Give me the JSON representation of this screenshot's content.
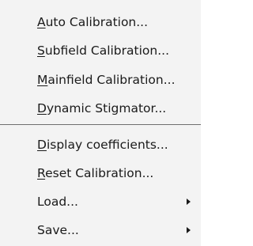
{
  "menu": {
    "items": [
      {
        "mnemonic": "A",
        "rest": "uto Calibration...",
        "submenu": false
      },
      {
        "mnemonic": "S",
        "rest": "ubfield Calibration...",
        "submenu": false
      },
      {
        "mnemonic": "M",
        "rest": "ainfield Calibration...",
        "submenu": false
      },
      {
        "mnemonic": "D",
        "rest": "ynamic Stigmator...",
        "submenu": false
      },
      {
        "mnemonic": "D",
        "rest": "isplay coefficients...",
        "submenu": false
      },
      {
        "mnemonic": "R",
        "rest": "eset Calibration...",
        "submenu": false
      },
      {
        "mnemonic": "",
        "rest": "Load...",
        "submenu": true
      },
      {
        "mnemonic": "",
        "rest": "Save...",
        "submenu": true
      }
    ],
    "arrow_icon": "submenu-arrow-icon",
    "colors": {
      "background": "#f3f3f3",
      "text": "#1a1a1a",
      "separator": "#6f6f6f"
    }
  }
}
